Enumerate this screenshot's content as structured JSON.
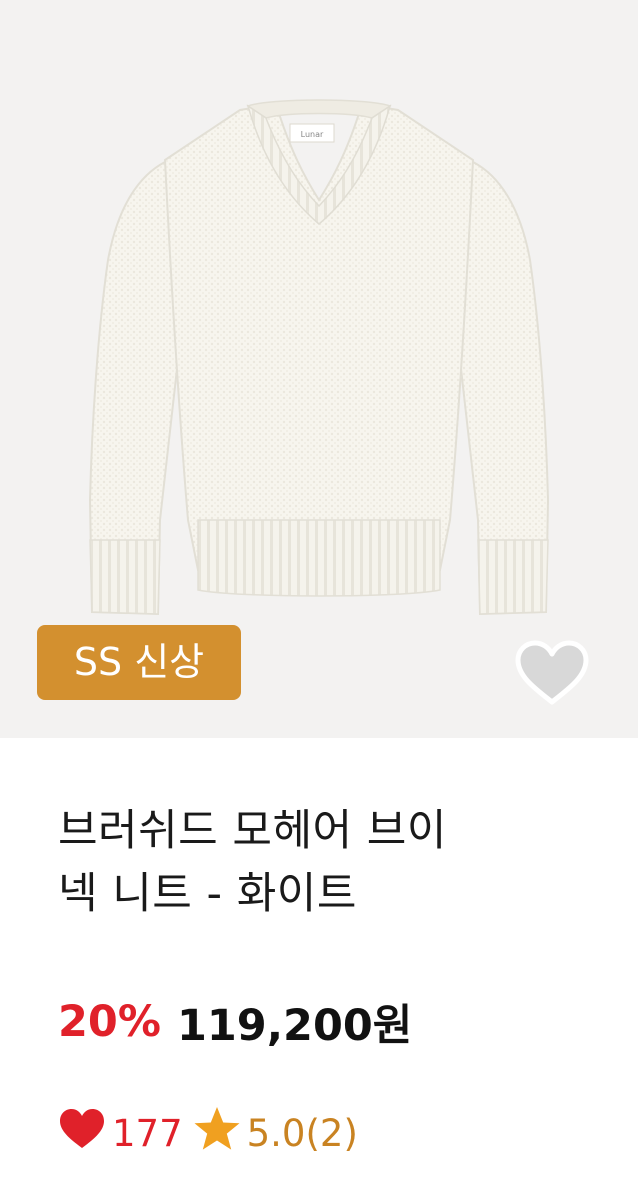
{
  "product": {
    "badge": "SS 신상",
    "title_line1": "브러쉬드 모헤어 브이",
    "title_line2": "넥 니트 - 화이트",
    "discount": "20%",
    "price": "119,200원",
    "like_count": "177",
    "rating": "5.0(2)",
    "neck_label_text": "Lunar",
    "image_subject": "white v-neck knit sweater"
  },
  "icons": {
    "wish": "heart-outline-icon",
    "like": "heart-filled-icon",
    "rating": "star-icon"
  },
  "colors": {
    "badge_bg": "#d3902f",
    "discount": "#e0212a",
    "like": "#e0212a",
    "rating": "#c98322",
    "image_bg": "#f3f2f1",
    "wish_heart_fill": "#d8d8d8"
  }
}
